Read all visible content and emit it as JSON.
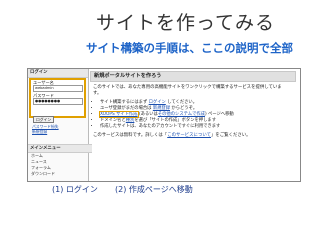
{
  "slide": {
    "title": "サイトを作ってみる",
    "subtitle": "サイト構築の手順は、ここの説明で全部"
  },
  "sidebar": {
    "login_heading": "ログイン",
    "user_name_label": "ユーザー名",
    "user_name_value": "webadmin",
    "password_label": "パスワード",
    "password_value": "●●●●●●●●",
    "login_button": "ログイン",
    "register_link": "パスワード紛失",
    "new_register_link": "新規登録",
    "menu_heading": "メインメニュー",
    "menu_items": [
      "ホーム",
      "ニュース",
      "フォーラム",
      "ダウンロード"
    ]
  },
  "main": {
    "heading": "新規ポータルサイトを作ろう",
    "intro_line1": "このサイトでは、あなた専用の高機能サイトをワンクリックで構築するサービスを提供していま",
    "intro_line2": "す。",
    "bullets": [
      {
        "pre": "サイト構築するにはまず ",
        "link": "ログイン",
        "post": " してください。"
      },
      {
        "pre": "ユーザ登録がまだの場合は ",
        "link": "新規登録",
        "post": " からどうぞ。"
      },
      {
        "pre": "",
        "link": "XOOPS サイト作成",
        "post": " (あるいは",
        "link2": "その他のシステムで作成",
        "post2": ") ページへ移動"
      },
      {
        "pre": "ドメイン名と",
        "link": "種別",
        "post": "を選び「サイトの作成」ボタンを押します"
      },
      {
        "pre": "作成したサイトは、あなたのアカウントですぐに利用できます",
        "link": "",
        "post": ""
      }
    ],
    "footer_pre": "このサービスは無料です。詳しくは「",
    "footer_link": "このサービスについて",
    "footer_post": "」をご覧ください。"
  },
  "steps": {
    "step1": "(1) ログイン",
    "step2": "(2) 作成ページへ移動"
  }
}
